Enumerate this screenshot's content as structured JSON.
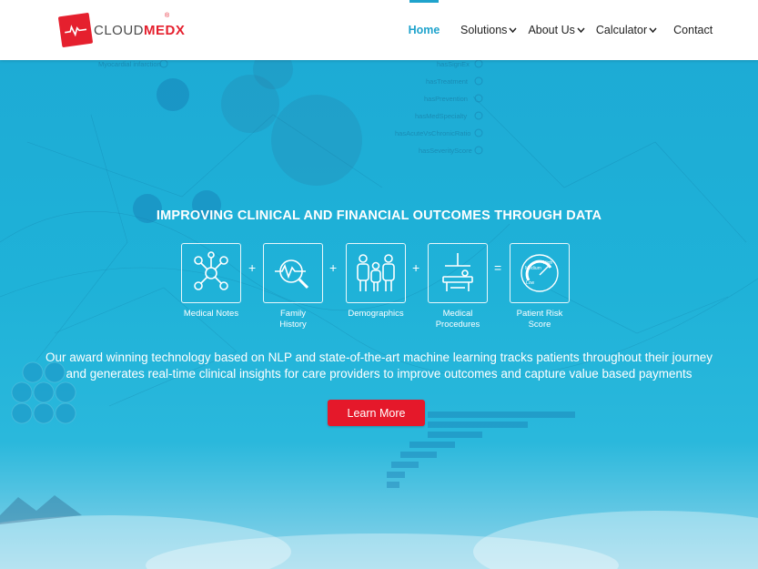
{
  "brand": {
    "name_part1": "CLOUD",
    "name_part2": "MEDX",
    "reg": "®"
  },
  "nav": {
    "items": [
      {
        "label": "Home",
        "active": true,
        "dropdown": false
      },
      {
        "label": "Solutions",
        "active": false,
        "dropdown": true
      },
      {
        "label": "About Us",
        "active": false,
        "dropdown": true
      },
      {
        "label": "Calculator",
        "active": false,
        "dropdown": true
      },
      {
        "label": "Contact",
        "active": false,
        "dropdown": false
      }
    ],
    "chevron": "⌄"
  },
  "hero": {
    "headline": "IMPROVING CLINICAL AND FINANCIAL OUTCOMES THROUGH DATA",
    "formula": [
      {
        "icon": "network-nodes-icon",
        "caption": "Medical Notes"
      },
      {
        "icon": "magnifier-heartbeat-icon",
        "caption": "Family History"
      },
      {
        "icon": "people-group-icon",
        "caption": "Demographics"
      },
      {
        "icon": "medical-procedure-icon",
        "caption": "Medical Procedures"
      },
      {
        "icon": "risk-gauge-icon",
        "caption": "Patient Risk Score"
      }
    ],
    "operators": [
      "+",
      "+",
      "+",
      "="
    ],
    "gauge_labels": {
      "high": "High",
      "medium": "Medium",
      "low": "Low"
    },
    "description": "Our award winning technology based on NLP and state-of-the-art machine learning tracks patients throughout their journey and generates real-time clinical insights for care providers to improve outcomes and capture value based payments",
    "cta_label": "Learn More",
    "background_labels": [
      "Myocardial infarction",
      "hasSignEx",
      "hasTreatment",
      "hasPrevention",
      "hasMedSpecialty",
      "hasAcuteVsChronicRatio",
      "hasSeverityScore"
    ]
  },
  "colors": {
    "accent": "#1fa3cc",
    "brand_red": "#e5202e",
    "cta_red": "#e5182a",
    "hero_blue": "#1fb0d6"
  }
}
